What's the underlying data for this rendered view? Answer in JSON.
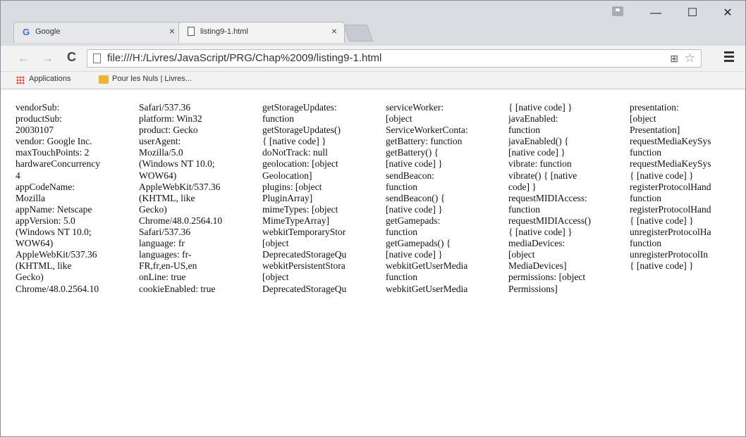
{
  "tabs": [
    {
      "title": "Google",
      "icon": "google-icon",
      "close": "×"
    },
    {
      "title": "listing9-1.html",
      "icon": "page-icon",
      "close": "×"
    }
  ],
  "window_controls": {
    "minimize": "—",
    "maximize": "☐",
    "close": "✕"
  },
  "toolbar": {
    "back": "←",
    "forward": "→",
    "reload": "C",
    "url": "file:///H:/Livres/JavaScript/PRG/Chap%2009/listing9-1.html"
  },
  "bookmarks": [
    {
      "label": "Applications",
      "icon": "apps-grid-icon"
    },
    {
      "label": "Pour les Nuls | Livres...",
      "icon": "folder-icon"
    }
  ],
  "columns": [
    [
      "vendorSub:",
      "productSub:",
      "20030107",
      "vendor: Google Inc.",
      "maxTouchPoints: 2",
      "hardwareConcurrency",
      "4",
      "appCodeName:",
      "Mozilla",
      "appName: Netscape",
      "appVersion: 5.0",
      "(Windows NT 10.0;",
      "WOW64)",
      "AppleWebKit/537.36",
      "(KHTML, like",
      "Gecko)",
      "Chrome/48.0.2564.10"
    ],
    [
      "Safari/537.36",
      "platform: Win32",
      "product: Gecko",
      "userAgent:",
      "Mozilla/5.0",
      "(Windows NT 10.0;",
      "WOW64)",
      "AppleWebKit/537.36",
      "(KHTML, like",
      "Gecko)",
      "Chrome/48.0.2564.10",
      "Safari/537.36",
      "language: fr",
      "languages: fr-",
      "FR,fr,en-US,en",
      "onLine: true",
      "cookieEnabled: true"
    ],
    [
      "getStorageUpdates:",
      "function",
      "getStorageUpdates()",
      "{ [native code] }",
      "doNotTrack: null",
      "geolocation: [object",
      "Geolocation]",
      "plugins: [object",
      "PluginArray]",
      "mimeTypes: [object",
      "MimeTypeArray]",
      "webkitTemporaryStor",
      "[object",
      "DeprecatedStorageQu",
      "webkitPersistentStora",
      "[object",
      "DeprecatedStorageQu"
    ],
    [
      "serviceWorker:",
      "[object",
      "ServiceWorkerConta:",
      "getBattery: function",
      "getBattery() {",
      "[native code] }",
      "sendBeacon:",
      "function",
      "sendBeacon() {",
      "[native code] }",
      "getGamepads:",
      "function",
      "getGamepads() {",
      "[native code] }",
      "webkitGetUserMedia",
      "function",
      "webkitGetUserMedia"
    ],
    [
      "{ [native code] }",
      "javaEnabled:",
      "function",
      "javaEnabled() {",
      "[native code] }",
      "vibrate: function",
      "vibrate() { [native",
      "code] }",
      "requestMIDIAccess:",
      "function",
      "requestMIDIAccess()",
      "{ [native code] }",
      "mediaDevices:",
      "[object",
      "MediaDevices]",
      "permissions: [object",
      "Permissions]"
    ],
    [
      "presentation:",
      "[object",
      "Presentation]",
      "requestMediaKeySys",
      "function",
      "requestMediaKeySys",
      "{ [native code] }",
      "registerProtocolHand",
      "function",
      "registerProtocolHand",
      "{ [native code] }",
      "unregisterProtocolHa",
      "function",
      "unregisterProtocolIn",
      "{ [native code] }"
    ]
  ]
}
